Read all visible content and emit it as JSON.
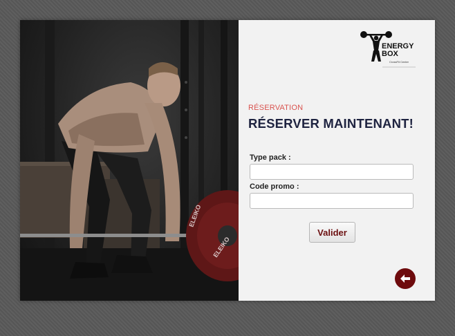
{
  "brand": {
    "line1": "ENERGY",
    "line2": "BOX",
    "tagline": "CrossFit Center"
  },
  "reservation": {
    "eyebrow": "RÉSERVATION",
    "title": "RÉSERVER MAINTENANT!"
  },
  "form": {
    "type_pack_label": "Type pack :",
    "type_pack_value": "",
    "promo_label": "Code promo :",
    "promo_value": "",
    "submit_label": "Valider"
  },
  "photo": {
    "plate_text_left": "ELEIKO",
    "plate_text_right": "ELEIKO"
  },
  "colors": {
    "accent": "#d9534f",
    "title": "#1e2340",
    "button_text": "#6b0f10",
    "back_button": "#6e0b0d"
  },
  "icons": {
    "back": "arrow-left-icon",
    "logo": "weightlifter-icon"
  }
}
